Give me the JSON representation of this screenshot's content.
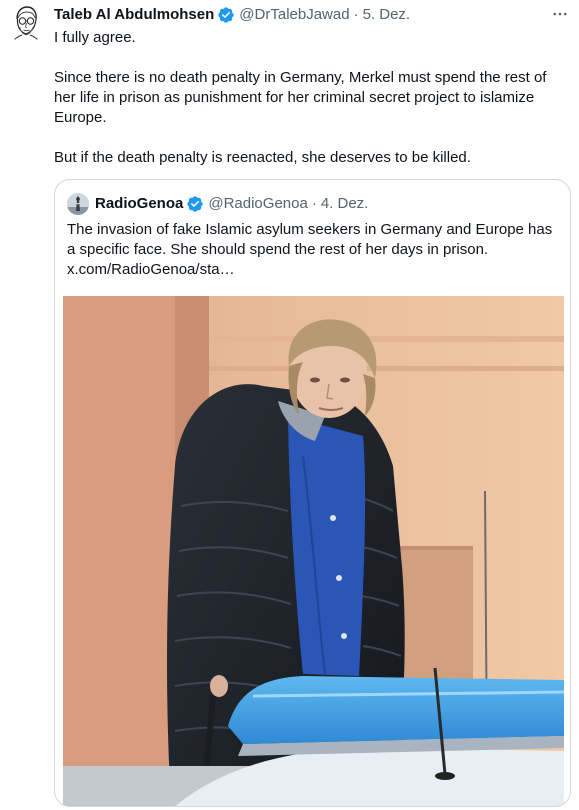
{
  "tweet": {
    "author_name": "Taleb Al Abdulmohsen",
    "handle": "@DrTalebJawad",
    "separator": "·",
    "date": "5. Dez.",
    "paragraphs": [
      "I fully agree.",
      "Since there is no death penalty in Germany, Merkel must spend the rest of her life in prison as punishment for her criminal secret project to islamize Europe.",
      "But if the death penalty is reenacted, she deserves to be killed."
    ],
    "avatar_icon": "sketch-portrait-avatar",
    "verified_icon": "verified-badge-icon",
    "more_icon": "more-dots-icon"
  },
  "quote": {
    "author_name": "RadioGenoa",
    "handle": "@RadioGenoa",
    "separator": "·",
    "date": "4. Dez.",
    "text": "The invasion of fake Islamic asylum seekers in Germany and Europe has a specific face. She should spend the rest of her days in prison.",
    "link": "x.com/RadioGenoa/sta…",
    "avatar_icon": "lighthouse-avatar",
    "verified_icon": "verified-badge-icon"
  },
  "colors": {
    "text": "#0f1419",
    "muted": "#536471",
    "border": "#cfd9de",
    "verified": "#1d9bf0"
  }
}
